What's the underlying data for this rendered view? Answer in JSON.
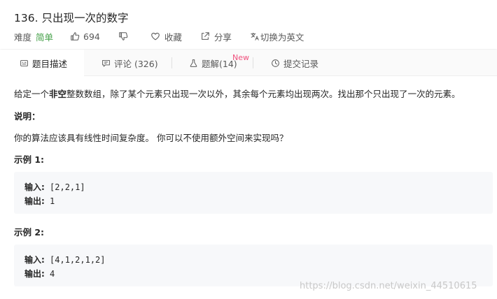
{
  "problem": {
    "title": "136. 只出现一次的数字",
    "difficulty_label": "难度",
    "difficulty_value": "简单",
    "likes": "694",
    "favorite_label": "收藏",
    "share_label": "分享",
    "translate_label": "切换为英文"
  },
  "tabs": [
    {
      "label": "题目描述"
    },
    {
      "label": "评论 (326)"
    },
    {
      "label": "题解(14)"
    },
    {
      "label": "提交记录"
    }
  ],
  "new_badge": "New",
  "description": {
    "intro_pre": "给定一个",
    "intro_bold": "非空",
    "intro_post": "整数数组，除了某个元素只出现一次以外，其余每个元素均出现两次。找出那个只出现了一次的元素。",
    "note_heading": "说明：",
    "note_text": "你的算法应该具有线性时间复杂度。 你可以不使用额外空间来实现吗？",
    "examples": [
      {
        "heading": "示例 1:",
        "input_label": "输入:",
        "input_value": " [2,2,1]",
        "output_label": "输出:",
        "output_value": " 1"
      },
      {
        "heading": "示例 2:",
        "input_label": "输入:",
        "input_value": " [4,1,2,1,2]",
        "output_label": "输出:",
        "output_value": " 4"
      }
    ]
  },
  "watermark": "https://blog.csdn.net/weixin_44510615"
}
